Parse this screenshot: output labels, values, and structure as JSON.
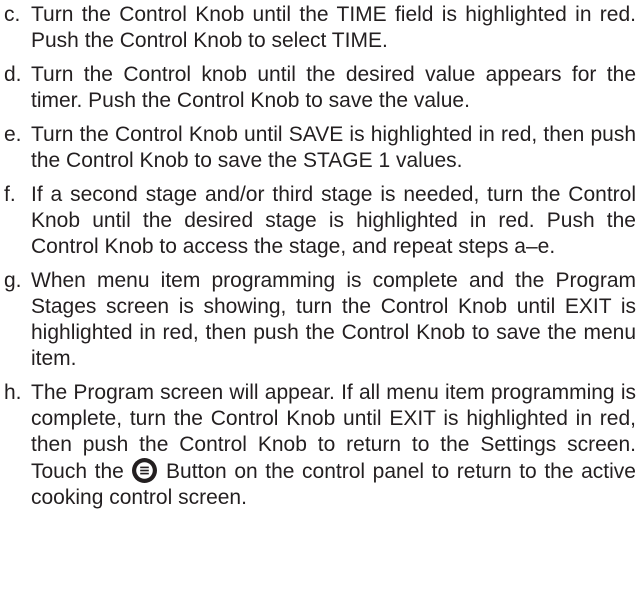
{
  "steps": [
    {
      "letter": "c.",
      "text": "Turn the Control Knob until the TIME field is highlighted in red. Push the Control Knob to select TIME."
    },
    {
      "letter": "d.",
      "text": "Turn the Control knob until the desired value appears for the timer. Push the Control Knob to save the value."
    },
    {
      "letter": "e.",
      "text": "Turn the Control Knob until SAVE is highlighted in red, then push the Control Knob to save the STAGE 1 values."
    },
    {
      "letter": "f.",
      "text": "If a second stage and/or third stage is needed, turn the Control Knob until the desired stage is highlighted in red. Push the Control Knob to access the stage, and repeat steps a–e."
    },
    {
      "letter": "g.",
      "text": "When menu item programming is complete and the Program Stages screen is showing, turn the Control Knob until EXIT is highlighted in red, then push the Control Knob to save the menu item."
    },
    {
      "letter": "h.",
      "text_before_icon": "The Program screen will appear. If all menu item programming is complete, turn the Control Knob until EXIT is highlighted in red, then push the Control Knob to return to the Settings screen. Touch the",
      "icon": "menu-button-icon",
      "text_after_icon": "Button on the control panel to return to the active cooking control screen."
    }
  ]
}
